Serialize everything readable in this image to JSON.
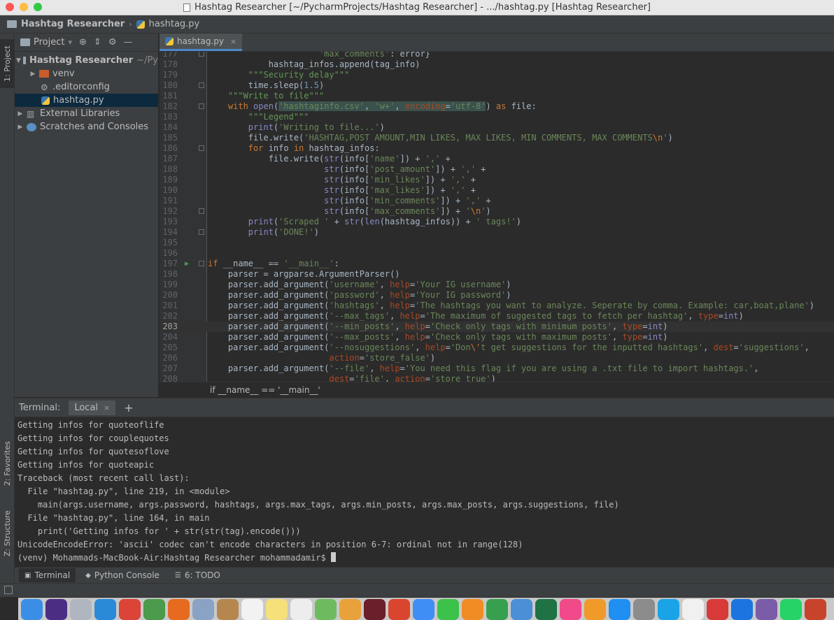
{
  "window": {
    "title": "Hashtag Researcher [~/PycharmProjects/Hashtag Researcher] - .../hashtag.py [Hashtag Researcher]"
  },
  "navbar": {
    "project": "Hashtag Researcher",
    "file": "hashtag.py"
  },
  "leftstrip": {
    "project_tab": "1: Project",
    "favorites_tab": "2: Favorites",
    "structure_tab": "Z: Structure"
  },
  "project_panel": {
    "title": "Project",
    "tree": [
      {
        "label": "Hashtag Researcher",
        "suffix": "~/Py"
      },
      {
        "label": "venv"
      },
      {
        "label": ".editorconfig"
      },
      {
        "label": "hashtag.py"
      },
      {
        "label": "External Libraries"
      },
      {
        "label": "Scratches and Consoles"
      }
    ]
  },
  "editor": {
    "tab_label": "hashtag.py",
    "breadcrumb": "if __name__ == '__main__'",
    "line_numbers": [
      "177",
      "178",
      "179",
      "180",
      "181",
      "182",
      "183",
      "184",
      "185",
      "186",
      "187",
      "188",
      "189",
      "190",
      "191",
      "192",
      "193",
      "194",
      "195",
      "196",
      "197",
      "198",
      "199",
      "200",
      "201",
      "202",
      "203",
      "204",
      "205",
      "206",
      "207",
      "208"
    ]
  },
  "terminal": {
    "label": "Terminal:",
    "tab": "Local",
    "lines": [
      "Getting infos for quoteoflife",
      "Getting infos for couplequotes",
      "Getting infos for quotesoflove",
      "Getting infos for quoteapic",
      "Traceback (most recent call last):",
      "  File \"hashtag.py\", line 219, in <module>",
      "    main(args.username, args.password, hashtags, args.max_tags, args.min_posts, args.max_posts, args.suggestions, file)",
      "  File \"hashtag.py\", line 164, in main",
      "    print('Getting infos for ' + str(str(tag).encode()))",
      "UnicodeEncodeError: 'ascii' codec can't encode characters in position 6-7: ordinal not in range(128)"
    ],
    "prompt": "(venv) Mohammads-MacBook-Air:Hashtag Researcher mohammadamir$ "
  },
  "bottom_tabs": {
    "terminal": "Terminal",
    "python_console": "Python Console",
    "todo": "6: TODO"
  },
  "colors": {
    "bg": "#2b2b2b",
    "panel": "#3c3f41",
    "keyword": "#cc7832",
    "string": "#6a8759",
    "builtin": "#8888c6",
    "number": "#6897bb",
    "param": "#aa4926"
  },
  "dock_icons": [
    "finder-icon",
    "siri-icon",
    "launchpad-icon",
    "safari-icon",
    "chrome-icon",
    "globe-icon",
    "firefox-icon",
    "preview-icon",
    "contacts-icon",
    "calendar-icon",
    "notes-icon",
    "reminders-icon",
    "maps-icon",
    "photos-icon",
    "photobooth-icon",
    "popcorn-icon",
    "messages-icon",
    "facetime-icon",
    "pages-icon",
    "numbers-icon",
    "keynote-icon",
    "excel-icon",
    "itunes-icon",
    "books-icon",
    "appstore-icon",
    "settings-icon",
    "skype-icon",
    "textedit-icon",
    "flashcards-icon",
    "teamviewer-icon",
    "cyberduck-icon",
    "whatsapp-icon",
    "powerpoint-icon"
  ]
}
